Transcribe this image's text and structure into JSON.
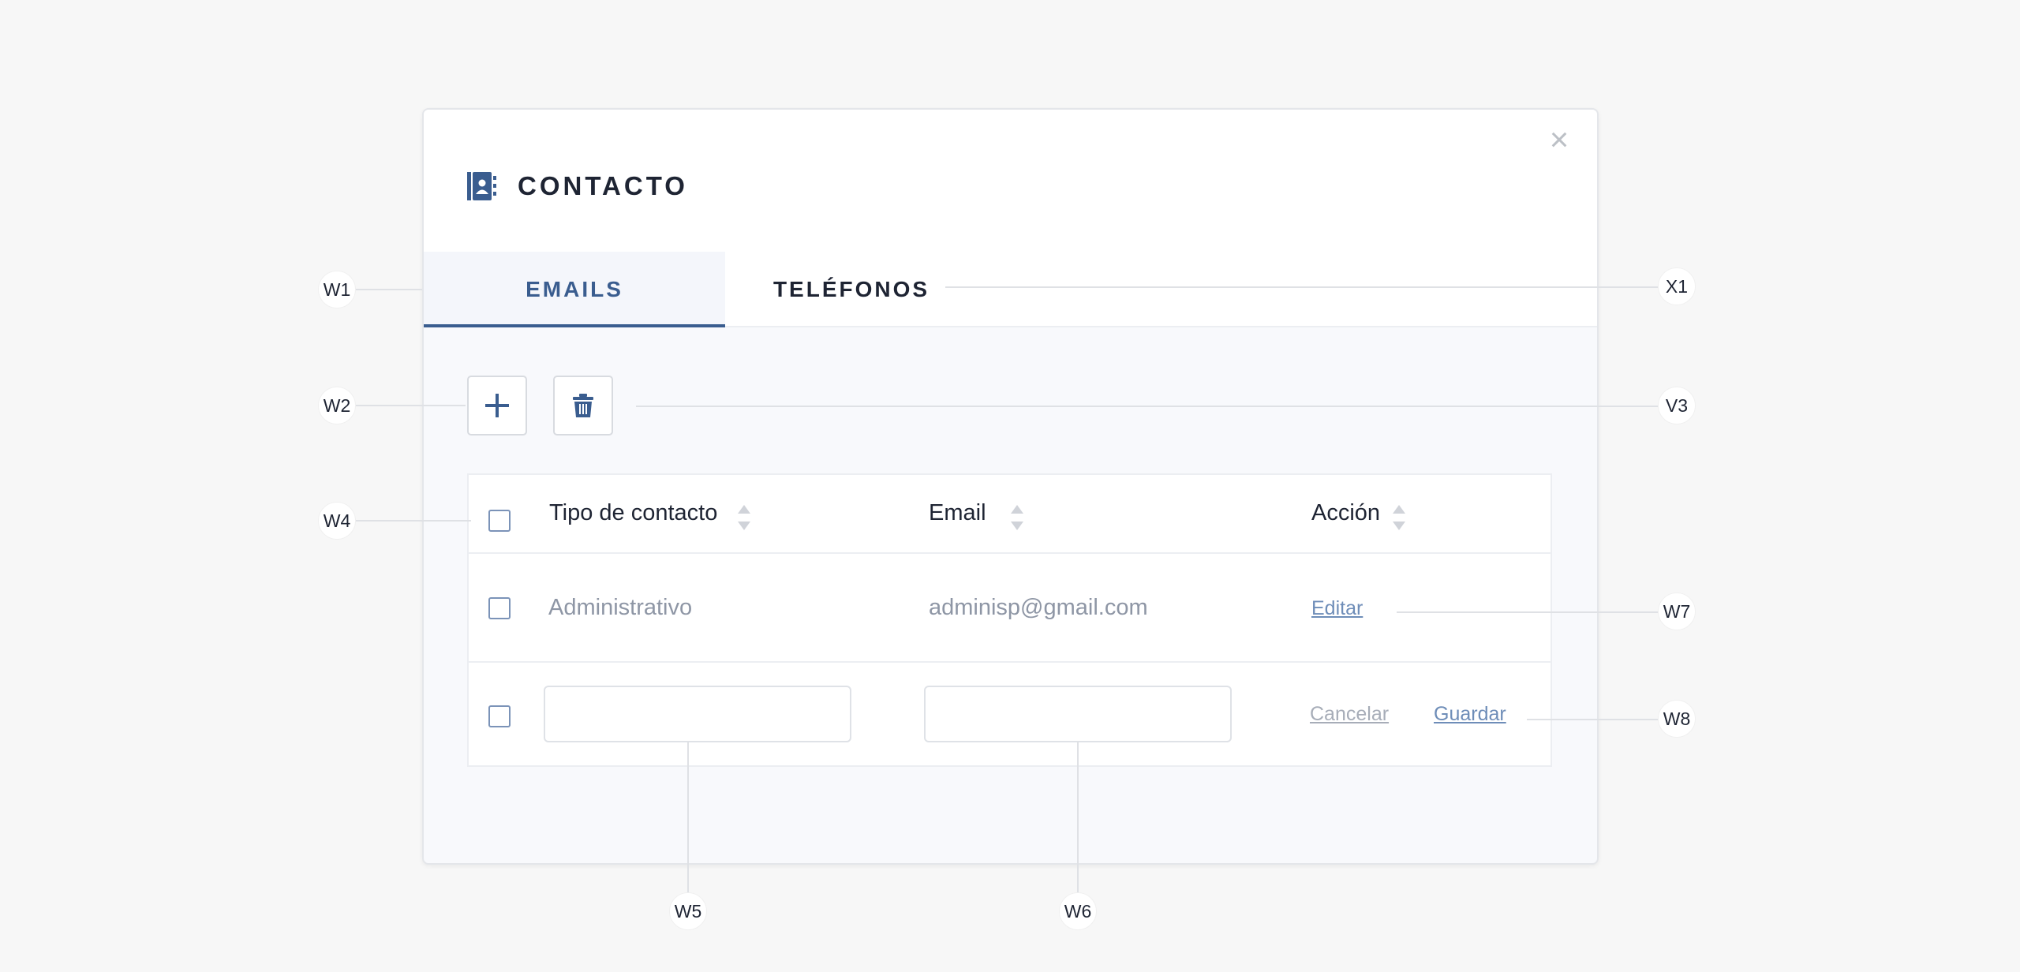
{
  "modal": {
    "title": "CONTACTO",
    "close_label": "×"
  },
  "tabs": [
    {
      "label": "EMAILS",
      "active": true
    },
    {
      "label": "TELÉFONOS",
      "active": false
    }
  ],
  "toolbar": {
    "add_icon": "plus-icon",
    "delete_icon": "trash-icon"
  },
  "table": {
    "columns": [
      "Tipo de contacto",
      "Email",
      "Acción"
    ],
    "rows": [
      {
        "tipo": "Administrativo",
        "email": "adminisp@gmail.com",
        "action": "Editar"
      }
    ],
    "edit_row": {
      "tipo_value": "",
      "email_value": "",
      "cancel_label": "Cancelar",
      "save_label": "Guardar"
    }
  },
  "annotations": {
    "W1": "W1",
    "X1": "X1",
    "W2": "W2",
    "V3": "V3",
    "W4": "W4",
    "W5": "W5",
    "W6": "W6",
    "W7": "W7",
    "W8": "W8"
  },
  "colors": {
    "accent": "#3a5d8f",
    "link": "#6e8db8",
    "background": "#f7f7f7",
    "modal_body": "#f8f9fc"
  }
}
